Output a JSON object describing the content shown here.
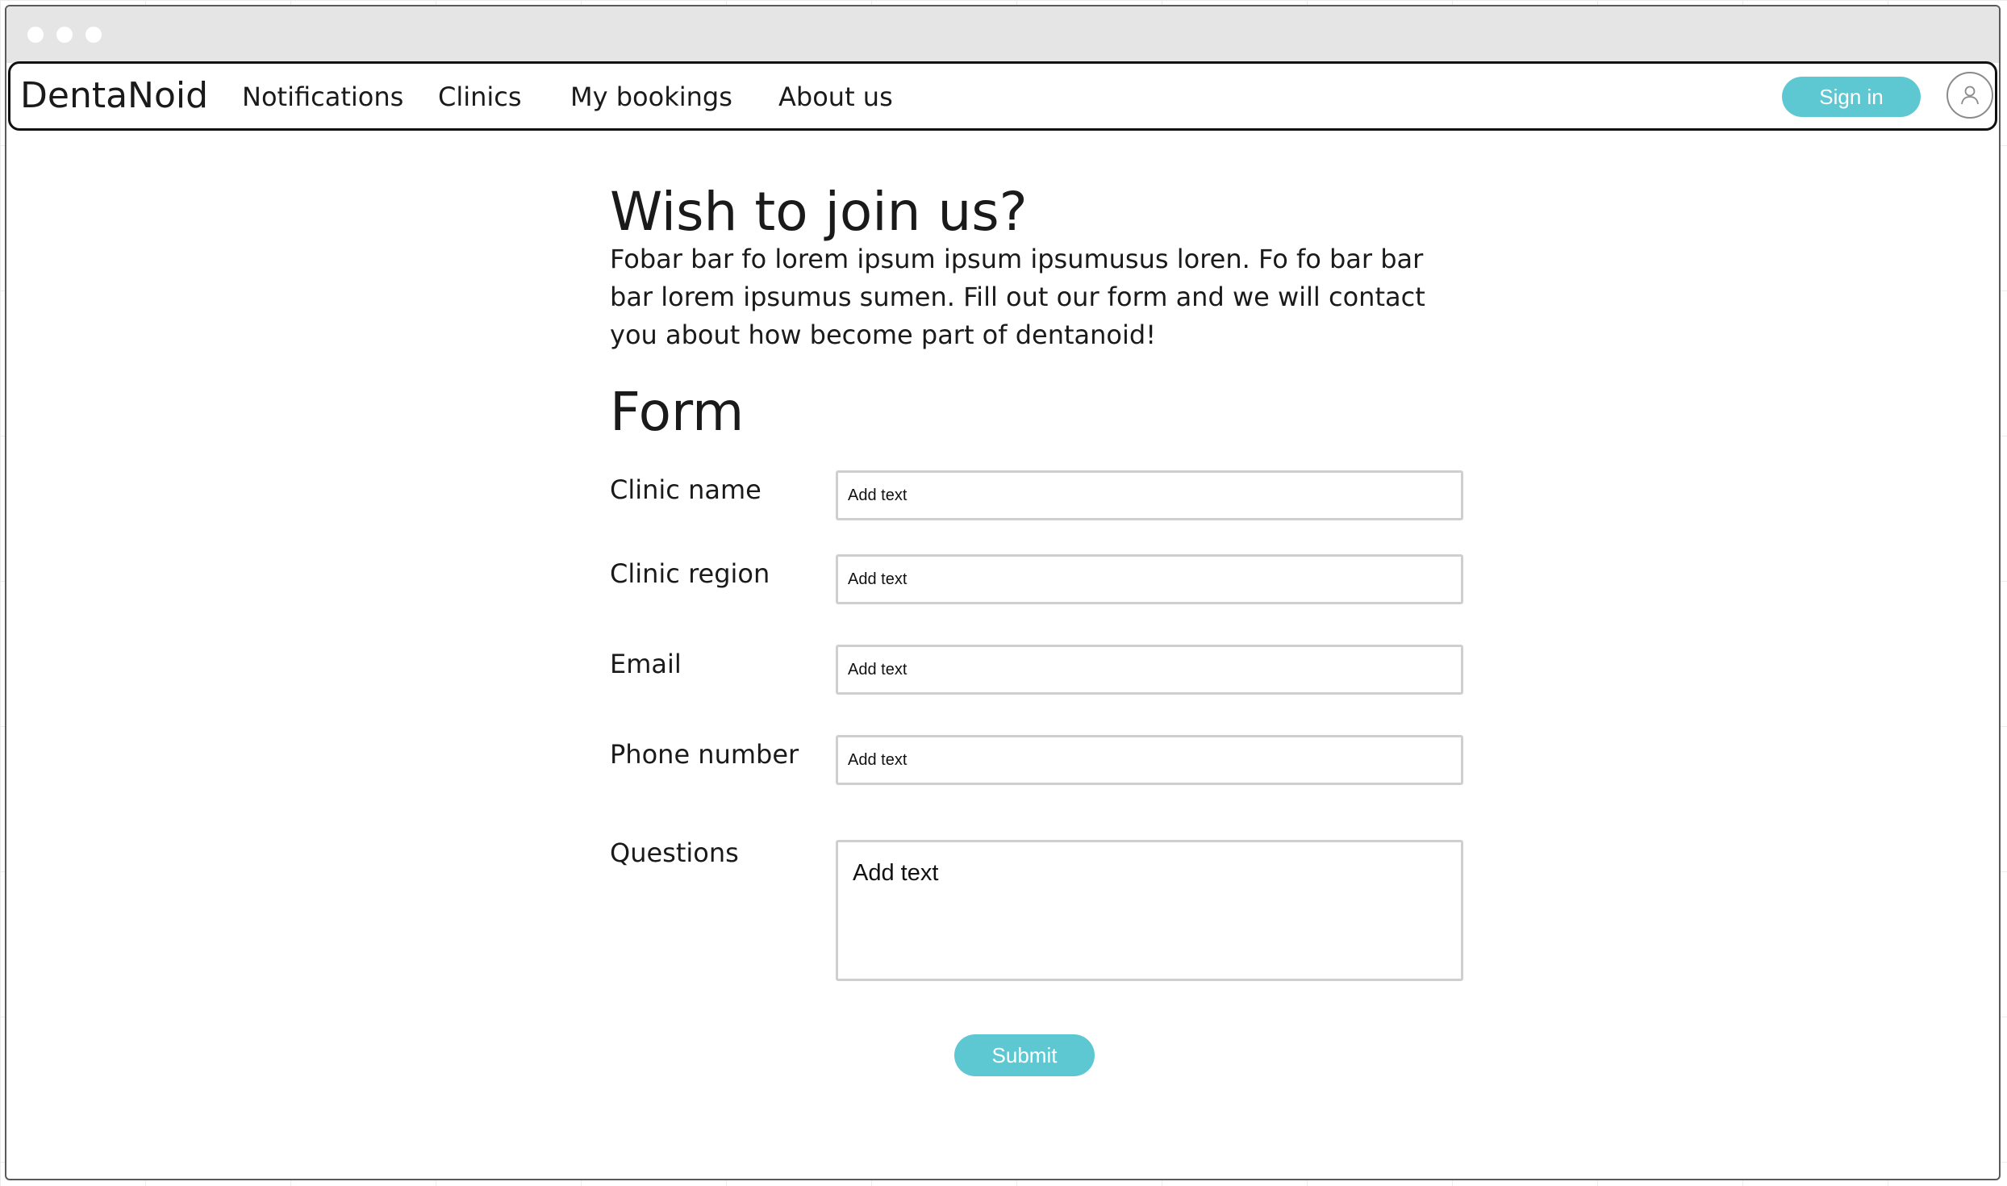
{
  "window": {
    "traffic_lights": [
      "close-dot",
      "minimize-dot",
      "zoom-dot"
    ]
  },
  "navbar": {
    "brand": "DentaNoid",
    "links": [
      {
        "label": "Notifications"
      },
      {
        "label": "Clinics"
      },
      {
        "label": "My bookings"
      },
      {
        "label": "About us"
      }
    ],
    "sign_in_label": "Sign in",
    "avatar_icon": "user-icon"
  },
  "main": {
    "heading": "Wish to join us?",
    "intro": "Fobar bar fo lorem ipsum ipsum ipsumusus loren. Fo fo bar bar bar lorem ipsumus sumen. Fill out our form and we will contact you about how become part of dentanoid!",
    "form_heading": "Form",
    "fields": [
      {
        "label": "Clinic name",
        "placeholder": "Add text"
      },
      {
        "label": "Clinic region",
        "placeholder": "Add text"
      },
      {
        "label": "Email",
        "placeholder": "Add text"
      },
      {
        "label": "Phone number",
        "placeholder": "Add text"
      },
      {
        "label": "Questions",
        "placeholder": "Add text"
      }
    ],
    "submit_label": "Submit"
  },
  "colors": {
    "accent": "#5ec8d2",
    "text": "#1a1a1a",
    "titlebar": "#e5e5e5",
    "input_border": "#cfcfcf"
  }
}
